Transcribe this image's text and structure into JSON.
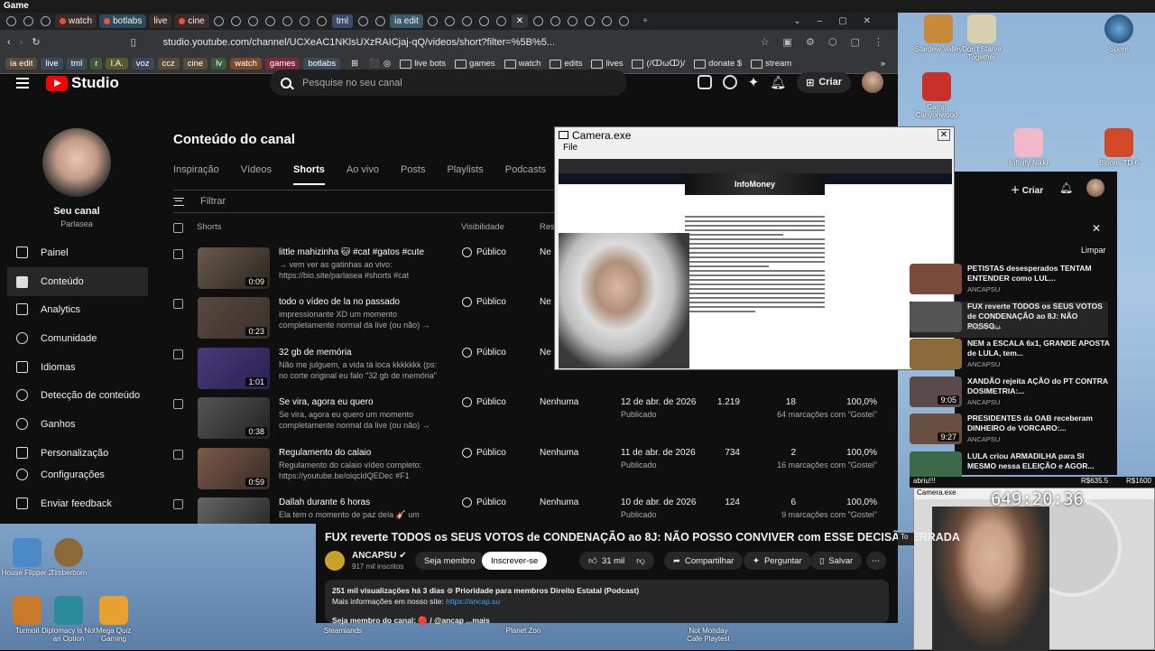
{
  "os": {
    "title": "Game"
  },
  "browser": {
    "tabs": [
      "watch",
      "botlabs",
      "live",
      "cine",
      "tml",
      "ia edit"
    ],
    "url": "studio.youtube.com/channel/UCXeAC1NKlsUXzRAICjaj-qQ/videos/short?filter=%5B%5...",
    "bookmarks": [
      "ia edit",
      "live",
      "tml",
      "r",
      "I.A.",
      "voz",
      "ccz",
      "cine",
      "lv",
      "watch",
      "games",
      "botlabs"
    ],
    "folders": [
      "live bots",
      "games",
      "watch",
      "edits",
      "lives",
      "(/ↀωↀ)/",
      "donate $",
      "stream"
    ]
  },
  "studio": {
    "brand": "Studio",
    "search_placeholder": "Pesquise no seu canal",
    "create_label": "Criar",
    "channel_label": "Seu canal",
    "channel_name": "Parlasea",
    "nav": [
      "Painel",
      "Conteúdo",
      "Analytics",
      "Comunidade",
      "Idiomas",
      "Detecção de conteúdo",
      "Ganhos",
      "Personalização",
      "Configurações",
      "Enviar feedback"
    ],
    "page_title": "Conteúdo do canal",
    "tabs": [
      "Inspiração",
      "Vídeos",
      "Shorts",
      "Ao vivo",
      "Posts",
      "Playlists",
      "Podcasts"
    ],
    "filter_placeholder": "Filtrar",
    "col_shorts": "Shorts",
    "col_visibility": "Visibilidade",
    "col_rest": "Res",
    "rows": [
      {
        "title": "little mahizinha 🐱 #cat #gatos #cute",
        "desc": "→ vem ver as gatinhas ao vivo: https://bio.site/parlasea #shorts #cat #gatos...",
        "dur": "0:09",
        "vis": "Público",
        "rest": "Ne",
        "date": "",
        "status": "",
        "views": "",
        "comments": "",
        "likes": "",
        "likes_sub": ""
      },
      {
        "title": "todo o vídeo de la no passado",
        "desc": "impressionante XD um momento completamente normal da live (ou não) → ve...",
        "dur": "0:23",
        "vis": "Público",
        "rest": "Ne",
        "date": "",
        "status": "",
        "views": "",
        "comments": "",
        "likes": "",
        "likes_sub": ""
      },
      {
        "title": "32 gb de memória",
        "desc": "Não me julguem, a vida tá loca kkkkkkk (ps: no corte original eu falo \"32 gb de memória\" mais...",
        "dur": "1:01",
        "vis": "Público",
        "rest": "Ne",
        "date": "",
        "status": "",
        "views": "",
        "comments": "",
        "likes": "",
        "likes_sub": ""
      },
      {
        "title": "Se vira, agora eu quero",
        "desc": "Se vira, agora eu quero um momento completamente normal da live (ou não) → ve...",
        "dur": "0:38",
        "vis": "Público",
        "rest": "Nenhuma",
        "date": "12 de abr. de 2026",
        "status": "Publicado",
        "views": "1.219",
        "comments": "18",
        "likes": "100,0%",
        "likes_sub": "64 marcações com \"Gostei\""
      },
      {
        "title": "Regulamento do calaio",
        "desc": "Regulamento do calaio vídeo completo: https://youtube.be/oiqcldQEDec #F1 #F12026...",
        "dur": "0:59",
        "vis": "Público",
        "rest": "Nenhuma",
        "date": "11 de abr. de 2026",
        "status": "Publicado",
        "views": "734",
        "comments": "2",
        "likes": "100,0%",
        "likes_sub": "16 marcações com \"Gostei\""
      },
      {
        "title": "Dallah durante 6 horas",
        "desc": "Ela tem o momento de paz dela 🎸 um",
        "dur": "",
        "vis": "Público",
        "rest": "Nenhuma",
        "date": "10 de abr. de 2026",
        "status": "Publicado",
        "views": "124",
        "comments": "6",
        "likes": "100,0%",
        "likes_sub": "9 marcações com \"Gostei\""
      }
    ]
  },
  "camera": {
    "title": "Camera.exe",
    "menu": "File",
    "brand": "InfoMoney"
  },
  "video": {
    "title": "FUX reverte TODOS os SEUS VOTOS de CONDENAÇÃO ao 8J: NÃO POSSO CONVIVER com ESSE DECISÃO ERRADA",
    "channel": "ANCAPSU",
    "subs": "917 mil inscritos",
    "member": "Seja membro",
    "subscribe": "Inscrever-se",
    "likes": "31 mil",
    "share": "Compartilhar",
    "ask": "Perguntar",
    "save": "Salvar",
    "desc1": "251 mil visualizações  há 3 dias  ⊙ Prioridade para membros  Direito Estatal (Podcast)",
    "desc2": "Mais informações em nosso site: ",
    "link": "https://ancap.su",
    "desc3": "Seja membro do canal: 🔴 / @ancap ...mais",
    "to": "To"
  },
  "right": {
    "icons": [
      "Stardew Valley",
      "Don't Starve Together",
      "Spore",
      "Camp Canyonwood",
      "Infinity Nikki",
      "Bloons TD 6"
    ],
    "create": "Criar",
    "clear": "Limpar",
    "feed": [
      {
        "title": "PETISTAS desesperados TENTAM ENTENDER como LUL...",
        "ch": "ANCAPSU",
        "time": ""
      },
      {
        "title": "FUX reverte TODOS os SEUS VOTOS de CONDENAÇÃO ao 8J: NÃO POSSO...",
        "ch": "ANCAPSU",
        "time": ""
      },
      {
        "title": "NEM a ESCALA 6x1, GRANDE APOSTA de LULA, tem...",
        "ch": "ANCAPSU",
        "time": ""
      },
      {
        "title": "XANDÃO rejeita AÇÃO do PT CONTRA DOSIMETRIA:...",
        "ch": "ANCAPSU",
        "time": "9:05"
      },
      {
        "title": "PRESIDENTES da OAB receberam DINHEIRO de VORCARO:...",
        "ch": "ANCAPSU",
        "time": "9:27"
      },
      {
        "title": "LULA criou ARMADILHA para SI MESMO nessa ELEIÇÃO e AGOR...",
        "ch": "ANCAPSU",
        "time": ""
      }
    ],
    "ticker_left": "abriu!!!",
    "ticker_right": "R$1600",
    "ticker_mid": "R$635.5",
    "clock": "649:20:36",
    "webcam_title": "Camera.exe"
  },
  "desktop": [
    "House Flipper 2",
    "Timberborn",
    "Turmoil",
    "Diplomacy is Not an Option",
    "Mega Quiz Gaming",
    "Steamlands",
    "Planet Zoo",
    "Not Monday Cafe Playtest"
  ]
}
